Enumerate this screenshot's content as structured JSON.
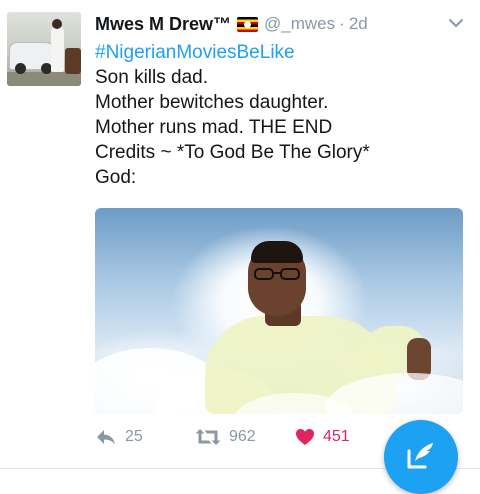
{
  "tweet": {
    "author_name": "Mwes M Drew™",
    "author_emoji": "uganda-flag",
    "handle": "@_mwes",
    "separator": "·",
    "time": "2d",
    "lines": [
      "#NigerianMoviesBeLike",
      "Son kills dad.",
      "Mother bewitches daughter.",
      "Mother runs mad. THE END",
      "Credits ~ *To God Be The Glory*",
      "God:"
    ],
    "media": "photo-man-in-clouds"
  },
  "actions": {
    "reply_count": "25",
    "retweet_count": "962",
    "like_count": "451",
    "liked": true
  },
  "colors": {
    "accent": "#1da1f2",
    "like": "#e0245e",
    "muted": "#8899a6",
    "text": "#14171a"
  },
  "icons": [
    "chevron-down-icon",
    "reply-icon",
    "retweet-icon",
    "heart-icon",
    "compose-icon"
  ]
}
